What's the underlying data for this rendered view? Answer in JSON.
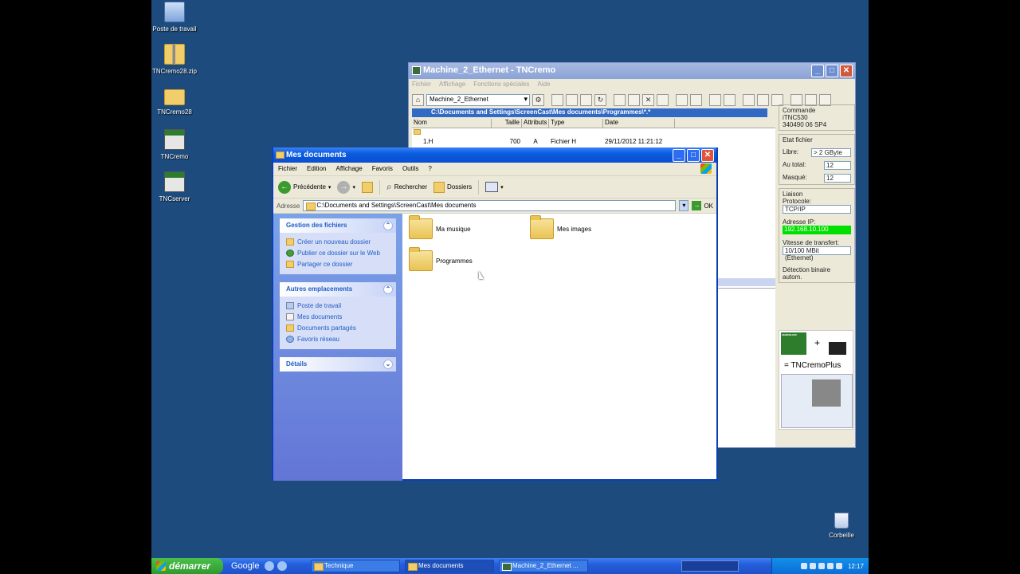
{
  "desktop": {
    "icons": [
      {
        "label": "Poste de travail",
        "icon": "computer-icon"
      },
      {
        "label": "TNCremo28.zip",
        "icon": "zip-folder-icon"
      },
      {
        "label": "TNCremo28",
        "icon": "folder-icon"
      },
      {
        "label": "TNCremo",
        "icon": "tncremo-icon"
      },
      {
        "label": "TNCserver",
        "icon": "tncserver-icon"
      }
    ],
    "recycle_bin": "Corbeille"
  },
  "tncremo": {
    "title": "Machine_2_Ethernet - TNCremo",
    "menu": [
      "Fichier",
      "Affichage",
      "Fonctions spéciales",
      "Aide"
    ],
    "connection_combo": "Machine_2_Ethernet",
    "path": "C:\\Documents and Settings\\ScreenCast\\Mes documents\\Programmes\\*.*",
    "columns": [
      "Nom",
      "Taille",
      "Attributs",
      "Type",
      "Date"
    ],
    "files": [
      {
        "name": "..",
        "size": "",
        "attr": "",
        "type": "",
        "date": ""
      },
      {
        "name": "1.H",
        "size": "700",
        "attr": "A",
        "type": "Fichier H",
        "date": "29/11/2012 11:21:12"
      }
    ],
    "side": {
      "commande_label": "Commande",
      "commande_model": "iTNC530",
      "commande_version": "340490 06 SP4",
      "etat_label": "Etat fichier",
      "libre_label": "Libre:",
      "libre_value": "> 2 GByte",
      "autotal_label": "Au total:",
      "autotal_value": "12",
      "masque_label": "Masqué:",
      "masque_value": "12",
      "liaison_label": "Liaison",
      "protocole_label": "Protocole:",
      "protocole_value": "TCP/IP",
      "ip_label": "Adresse IP:",
      "ip_value": "192.168.10.100",
      "vitesse_label": "Vitesse de transfert:",
      "vitesse_value": "10/100 MBit (Ethernet)",
      "detection": "Détection binaire autom.",
      "promo_text": "= TNCremoPlus",
      "promo_brand": "HEIDENHAIN"
    }
  },
  "mesdocs": {
    "title": "Mes documents",
    "menu": [
      "Fichier",
      "Edition",
      "Affichage",
      "Favoris",
      "Outils",
      "?"
    ],
    "toolbar": {
      "back": "Précédente",
      "search": "Rechercher",
      "folders": "Dossiers"
    },
    "address_label": "Adresse",
    "address_value": "C:\\Documents and Settings\\ScreenCast\\Mes documents",
    "ok_label": "OK",
    "tasks": {
      "files_title": "Gestion des fichiers",
      "files_links": [
        "Créer un nouveau dossier",
        "Publier ce dossier sur le Web",
        "Partager ce dossier"
      ],
      "places_title": "Autres emplacements",
      "places_links": [
        "Poste de travail",
        "Mes documents",
        "Documents partagés",
        "Favoris réseau"
      ],
      "details_title": "Détails"
    },
    "folders": [
      "Ma musique",
      "Mes images",
      "Programmes"
    ]
  },
  "taskbar": {
    "start": "démarrer",
    "google": "Google",
    "buttons": [
      "Technique",
      "Mes documents",
      "Machine_2_Ethernet ..."
    ],
    "clock": "12:17"
  }
}
